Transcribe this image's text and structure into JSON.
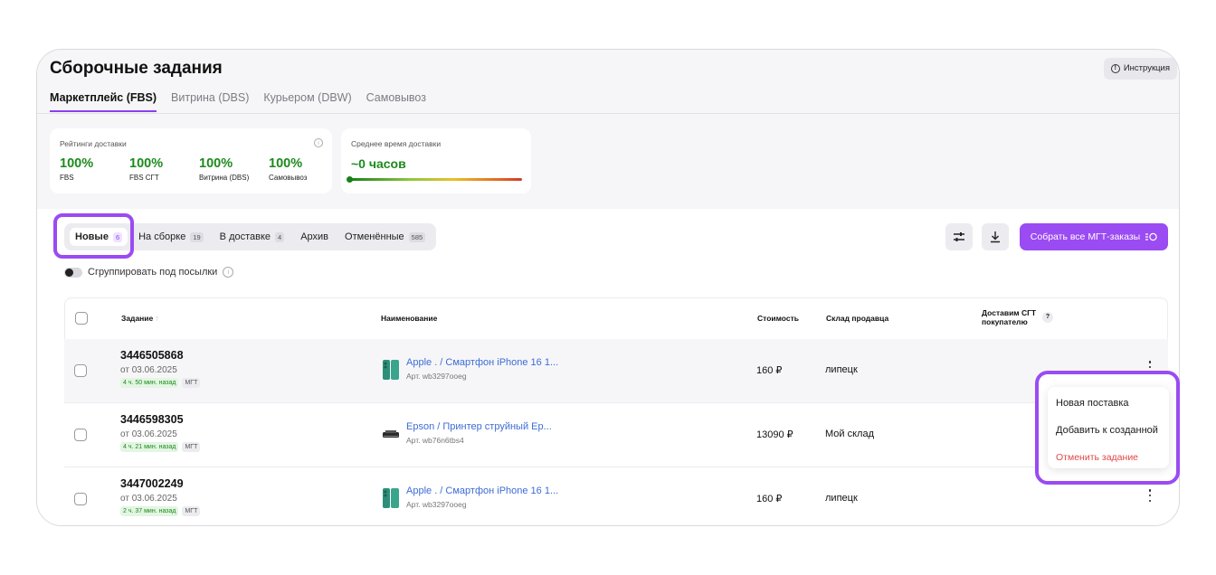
{
  "page": {
    "title": "Сборочные задания",
    "help_label": "Инструкция",
    "tabs": [
      {
        "label": "Маркетплейс (FBS)"
      },
      {
        "label": "Витрина (DBS)"
      },
      {
        "label": "Курьером (DBW)"
      },
      {
        "label": "Самовывоз"
      }
    ]
  },
  "ratings": {
    "label": "Рейтинги доставки",
    "items": [
      {
        "value": "100%",
        "label": "FBS"
      },
      {
        "value": "100%",
        "label": "FBS СГТ"
      },
      {
        "value": "100%",
        "label": "Витрина (DBS)"
      },
      {
        "value": "100%",
        "label": "Самовывоз"
      }
    ]
  },
  "avg_delivery": {
    "label": "Среднее время доставки",
    "value": "~0 часов"
  },
  "status_tabs": [
    {
      "label": "Новые",
      "count": "6"
    },
    {
      "label": "На сборке",
      "count": "19"
    },
    {
      "label": "В доставке",
      "count": "4"
    },
    {
      "label": "Архив",
      "count": ""
    },
    {
      "label": "Отменённые",
      "count": "585"
    }
  ],
  "actions": {
    "collect_label": "Собрать все МГТ-заказы"
  },
  "group_toggle": {
    "label": "Сгруппировать под посылки"
  },
  "table": {
    "headers": {
      "task": "Задание",
      "name": "Наименование",
      "price": "Стоимость",
      "warehouse": "Склад продавца",
      "sgt_line1": "Доставим СГТ",
      "sgt_line2": "покупателю"
    },
    "rows": [
      {
        "id": "3446505868",
        "date": "от 03.06.2025",
        "time": "4 ч. 50 мин. назад",
        "mgt": "МГТ",
        "name": "Apple . / Смартфон iPhone 16 1...",
        "art": "Арт. wb3297ooeg",
        "price": "160 ₽",
        "warehouse": "липецк",
        "thumb": "phone-thumbnail"
      },
      {
        "id": "3446598305",
        "date": "от 03.06.2025",
        "time": "4 ч. 21 мин. назад",
        "mgt": "МГТ",
        "name": "Epson / Принтер струйный Ep...",
        "art": "Арт. wb76n6tbs4",
        "price": "13090 ₽",
        "warehouse": "Мой склад",
        "thumb": "printer-thumbnail"
      },
      {
        "id": "3447002249",
        "date": "от 03.06.2025",
        "time": "2 ч. 37 мин. назад",
        "mgt": "МГТ",
        "name": "Apple . / Смартфон iPhone 16 1...",
        "art": "Арт. wb3297ooeg",
        "price": "160 ₽",
        "warehouse": "липецк",
        "thumb": "phone-thumbnail"
      }
    ]
  },
  "context_menu": {
    "items": [
      {
        "label": "Новая поставка"
      },
      {
        "label": "Добавить к созданной"
      },
      {
        "label": "Отменить задание",
        "danger": true
      }
    ]
  },
  "colors": {
    "accent": "#9a4bf2",
    "success": "#1c8a1c",
    "link": "#3d6cd6",
    "danger": "#e04848"
  }
}
